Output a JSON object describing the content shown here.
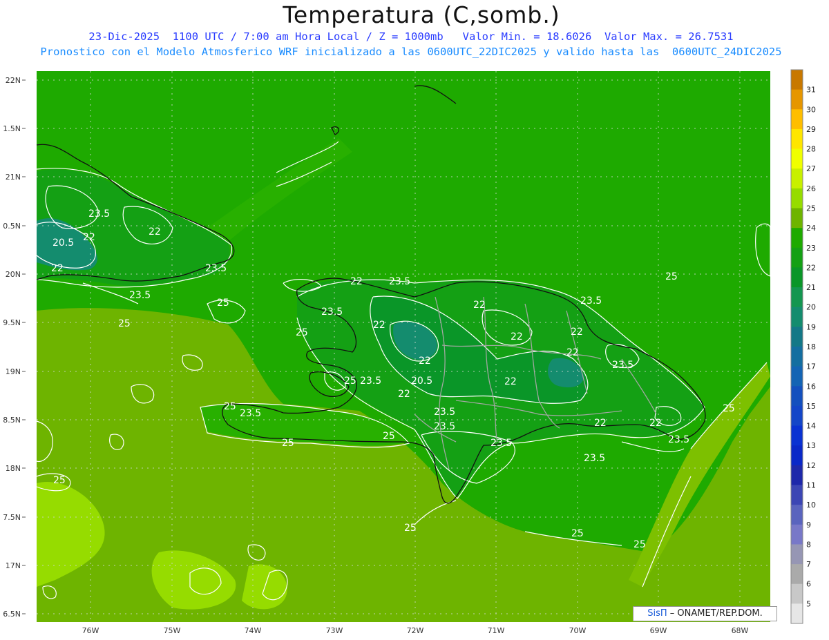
{
  "header": {
    "title": "Temperatura (C,somb.)",
    "subtitle1": "23-Dic-2025  1100 UTC / 7:00 am Hora Local / Z = 1000mb   Valor Min. = 18.6026  Valor Max. = 26.7531",
    "subtitle2": "Pronostico con el Modelo Atmosferico WRF inicializado a las 0600UTC_22DIC2025 y valido hasta las  0600UTC_24DIC2025"
  },
  "lat_labels": [
    "22N",
    "1.5N",
    "21N",
    "0.5N",
    "20N",
    "9.5N",
    "19N",
    "8.5N",
    "18N",
    "7.5N",
    "17N",
    "6.5N"
  ],
  "lon_labels": [
    "76W",
    "75W",
    "74W",
    "73W",
    "72W",
    "71W",
    "70W",
    "69W",
    "68W"
  ],
  "colorbar": {
    "labels": [
      "31",
      "30",
      "29",
      "28",
      "27",
      "26",
      "25",
      "24",
      "23",
      "22",
      "21",
      "20",
      "19",
      "18",
      "17",
      "16",
      "15",
      "14",
      "13",
      "12",
      "11",
      "10",
      "9",
      "8",
      "7",
      "6",
      "5"
    ],
    "colors": [
      "#c87800",
      "#e69600",
      "#ffbe00",
      "#ffe600",
      "#f0ff00",
      "#c8f000",
      "#96dc00",
      "#6eb400",
      "#1eaa00",
      "#14a014",
      "#0a9628",
      "#149650",
      "#148c6e",
      "#147887",
      "#146ea0",
      "#1464b4",
      "#1450be",
      "#1446c8",
      "#0a32d2",
      "#0a28c8",
      "#1e28aa",
      "#3c46b4",
      "#5a64be",
      "#7878c8",
      "#9696b4",
      "#aaaaaa",
      "#c8c8c8",
      "#e6e6e6"
    ]
  },
  "contour_labels": [
    {
      "text": "23.5"
    },
    {
      "text": "22"
    },
    {
      "text": "20.5"
    },
    {
      "text": "22"
    },
    {
      "text": "22"
    },
    {
      "text": "23.5"
    },
    {
      "text": "23.5"
    },
    {
      "text": "25"
    },
    {
      "text": "25"
    },
    {
      "text": "25"
    },
    {
      "text": "22"
    },
    {
      "text": "23.5"
    },
    {
      "text": "23.5"
    },
    {
      "text": "22"
    },
    {
      "text": "22"
    },
    {
      "text": "23.5"
    },
    {
      "text": "25"
    },
    {
      "text": "22"
    },
    {
      "text": "22"
    },
    {
      "text": "22"
    },
    {
      "text": "22"
    },
    {
      "text": "22"
    },
    {
      "text": "23.5"
    },
    {
      "text": "25"
    },
    {
      "text": "23.5"
    },
    {
      "text": "20.5"
    },
    {
      "text": "22"
    },
    {
      "text": "22"
    },
    {
      "text": "25"
    },
    {
      "text": "23.5"
    },
    {
      "text": "23.5"
    },
    {
      "text": "25"
    },
    {
      "text": "25"
    },
    {
      "text": "23.5"
    },
    {
      "text": "23.5"
    },
    {
      "text": "22"
    },
    {
      "text": "22"
    },
    {
      "text": "23.5"
    },
    {
      "text": "25"
    },
    {
      "text": "25"
    },
    {
      "text": "25"
    },
    {
      "text": "25"
    },
    {
      "text": "25"
    },
    {
      "text": "25"
    }
  ],
  "credit": {
    "brand": "SisΠ",
    "text": "– ONAMET/REP.DOM."
  }
}
